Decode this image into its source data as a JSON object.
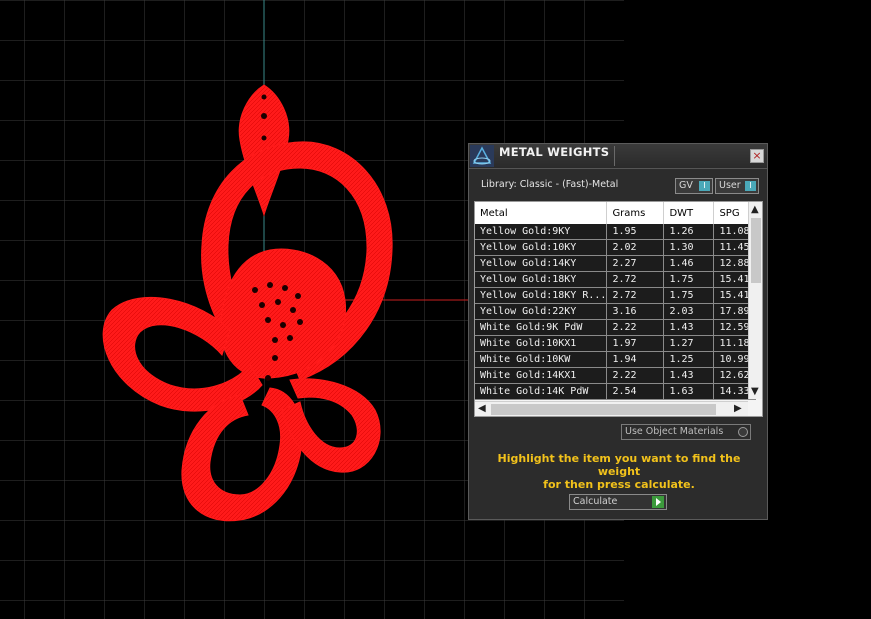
{
  "panel": {
    "title": "METAL WEIGHTS",
    "close_label": "×",
    "library": "Library: Classic - (Fast)-Metal",
    "gv_label": "GV",
    "user_label": "User",
    "toggle_glyph": "I"
  },
  "table": {
    "columns": [
      "Metal",
      "Grams",
      "DWT",
      "SPG"
    ],
    "rows": [
      [
        "Yellow Gold:9KY",
        "1.95",
        "1.26",
        "11.08"
      ],
      [
        "Yellow Gold:10KY",
        "2.02",
        "1.30",
        "11.45"
      ],
      [
        "Yellow Gold:14KY",
        "2.27",
        "1.46",
        "12.88"
      ],
      [
        "Yellow Gold:18KY",
        "2.72",
        "1.75",
        "15.41"
      ],
      [
        "Yellow Gold:18KY R...",
        "2.72",
        "1.75",
        "15.41"
      ],
      [
        "Yellow Gold:22KY",
        "3.16",
        "2.03",
        "17.89"
      ],
      [
        "White Gold:9K PdW",
        "2.22",
        "1.43",
        "12.59"
      ],
      [
        "White Gold:10KX1",
        "1.97",
        "1.27",
        "11.18"
      ],
      [
        "White Gold:10KW",
        "1.94",
        "1.25",
        "10.99"
      ],
      [
        "White Gold:14KX1",
        "2.22",
        "1.43",
        "12.62"
      ],
      [
        "White Gold:14K PdW",
        "2.54",
        "1.63",
        "14.33"
      ]
    ],
    "scroll_up": "▲",
    "scroll_down": "▼",
    "scroll_left": "◀",
    "scroll_right": "▶"
  },
  "use_object_materials": "Use Object Materials",
  "hint_line1": "Highlight the item you want to find the weight",
  "hint_line2": "for then press calculate.",
  "calculate_label": "Calculate",
  "colors": {
    "model": "#ff1a1a",
    "grid": "#3c3c3c",
    "axis_x": "#c82020",
    "axis_y": "#3a8a8a",
    "hint": "#f2c21b",
    "panel_bg": "#2c2c2c"
  }
}
